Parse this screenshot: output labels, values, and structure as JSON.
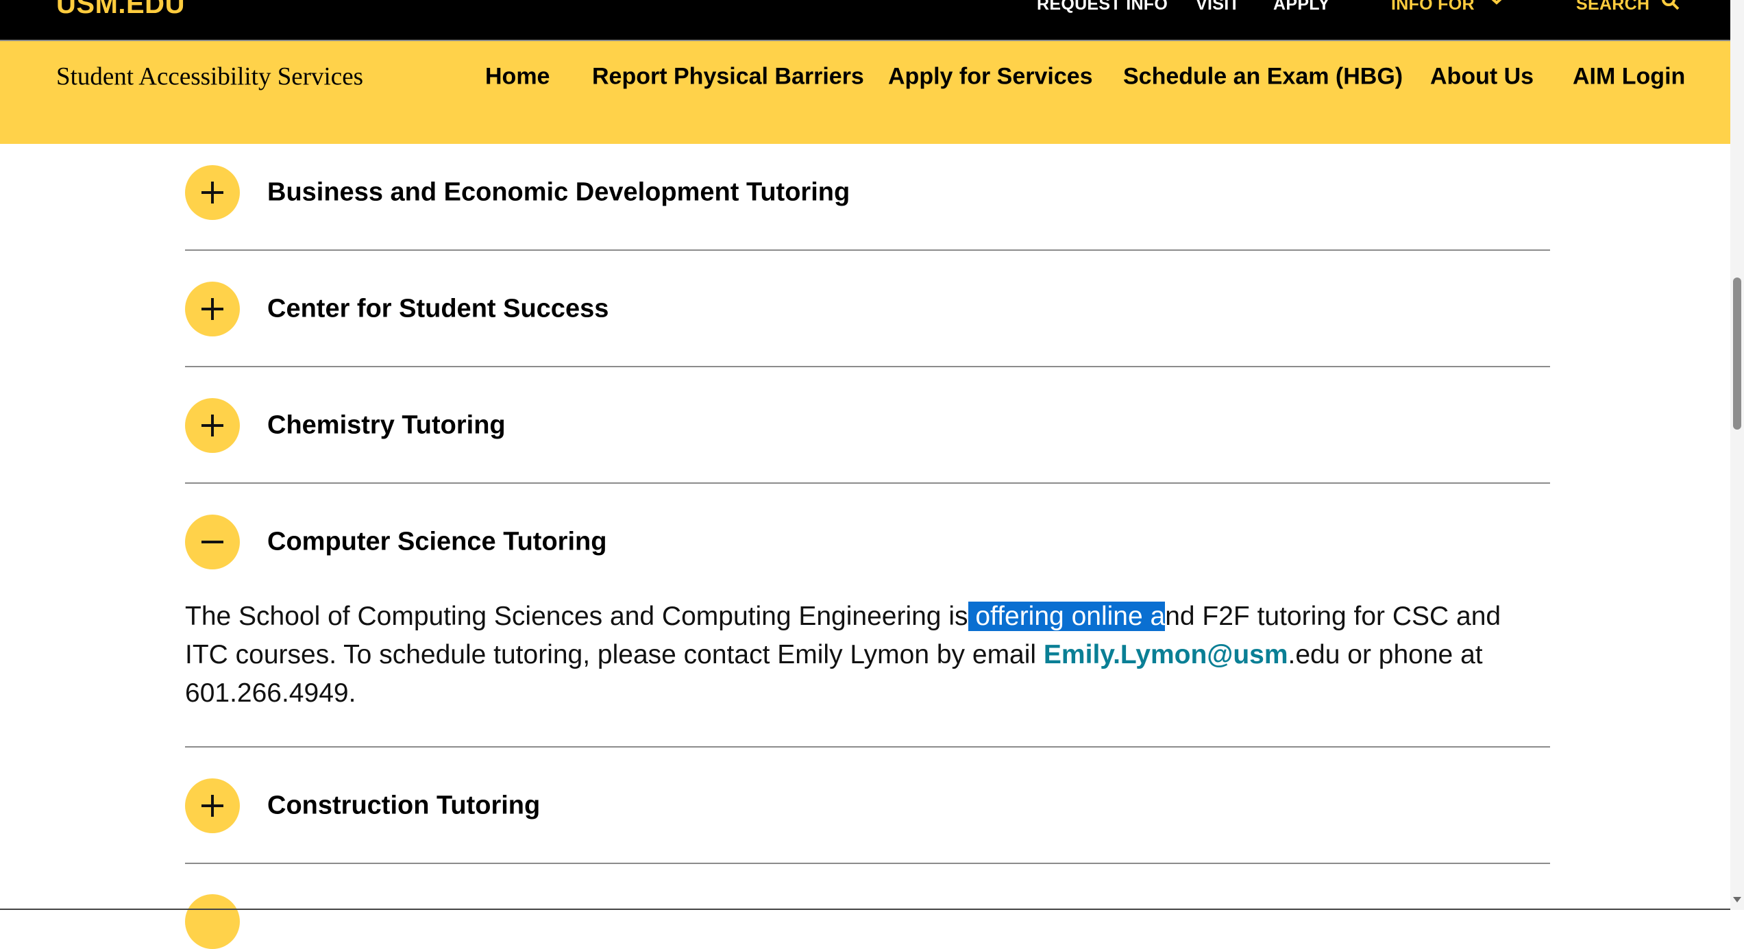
{
  "utility_bar": {
    "logo": "USM.EDU",
    "links": [
      "REQUEST INFO",
      "VISIT",
      "APPLY"
    ],
    "info_for": "INFO FOR",
    "search": "SEARCH"
  },
  "site_nav": {
    "site_name": "Student Accessibility Services",
    "items": [
      "Home",
      "Report Physical Barriers",
      "Apply for Services",
      "Schedule an Exam (HBG)",
      "About Us",
      "AIM Login"
    ]
  },
  "accordion": {
    "items": [
      {
        "title": "Business and Economic Development Tutoring",
        "expanded": false
      },
      {
        "title": "Center for Student Success",
        "expanded": false
      },
      {
        "title": "Chemistry Tutoring",
        "expanded": false
      },
      {
        "title": "Computer Science Tutoring",
        "expanded": true
      },
      {
        "title": "Construction Tutoring",
        "expanded": false
      }
    ],
    "expanded_content": {
      "text_before_selection": "The School of Computing Sciences and Computing Engineering is",
      "selected_text": " offering online a",
      "text_after_selection": "nd F2F tutoring for CSC and ITC courses. To schedule tutoring, please contact Emily Lymon by email ",
      "email_link": "Emily.Lymon@usm",
      "text_end": ".edu or phone at 601.266.4949."
    }
  },
  "colors": {
    "brand_gold": "#ffd24a",
    "utility_bg": "#000000",
    "selection": "#0a6fd1",
    "link": "#0a7f95"
  }
}
